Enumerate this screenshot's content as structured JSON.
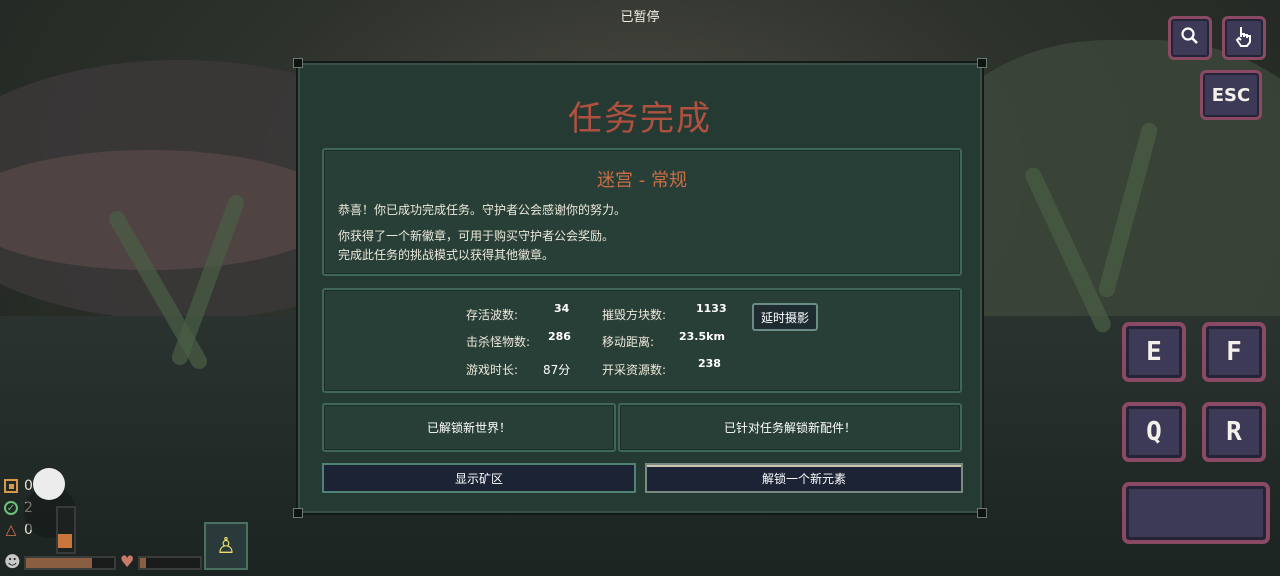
{
  "hud": {
    "paused_label": "已暂停",
    "esc_label": "ESC",
    "keys": {
      "e": "E",
      "f": "F",
      "q": "Q",
      "r": "R"
    },
    "resources": [
      "0",
      "2",
      "0"
    ]
  },
  "dialog": {
    "title": "任务完成",
    "mission_name": "迷宫 - 常规",
    "congrats": "恭喜！你已成功完成任务。守护者公会感谢你的努力。",
    "badge_line1": "你获得了一个新徽章，可用于购买守护者公会奖励。",
    "badge_line2": "完成此任务的挑战模式以获得其他徽章。",
    "stats": [
      {
        "label": "存活波数:",
        "value": "34"
      },
      {
        "label": "击杀怪物数:",
        "value": "286"
      },
      {
        "label": "游戏时长:",
        "value": "87分"
      },
      {
        "label": "摧毁方块数:",
        "value": "1133"
      },
      {
        "label": "移动距离:",
        "value": "23.5km"
      },
      {
        "label": "开采资源数:",
        "value": "238"
      }
    ],
    "timelapse_button": "延时摄影",
    "unlock_world": "已解锁新世界！",
    "unlock_part": "已针对任务解锁新配件！",
    "show_mining_button": "显示矿区",
    "unlock_element_button": "解锁一个新元素"
  },
  "colors": {
    "title": "#b0513f",
    "subtitle": "#c96d45",
    "button_border": "#8a4a64",
    "panel_border": "#3f6656"
  }
}
